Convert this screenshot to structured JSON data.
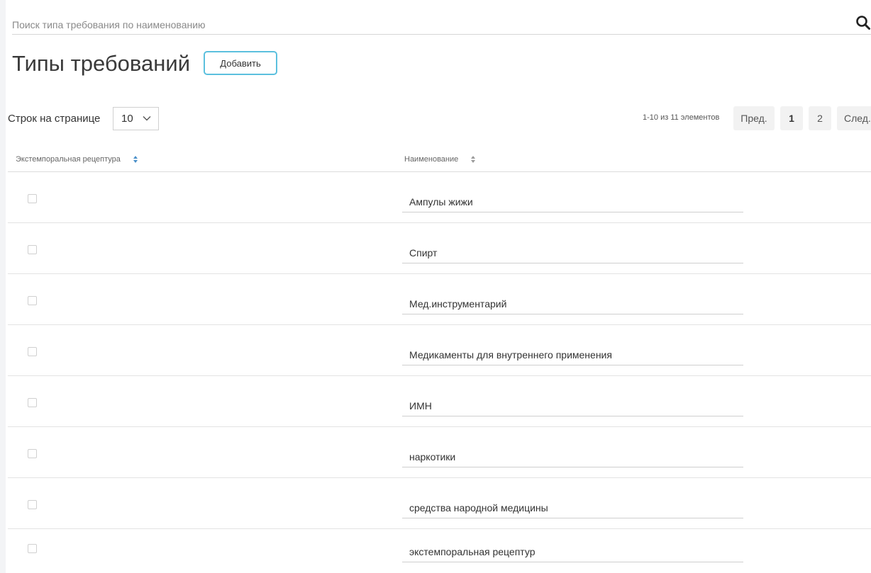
{
  "search": {
    "placeholder": "Поиск типа требования по наименованию",
    "value": ""
  },
  "page": {
    "title": "Типы требований",
    "add_label": "Добавить"
  },
  "rows_per_page": {
    "label": "Строк на странице",
    "value": "10"
  },
  "pagination": {
    "info": "1-10 из 11 элементов",
    "prev_label": "Пред.",
    "pages": [
      "1",
      "2"
    ],
    "current_page": "1",
    "next_label": "След."
  },
  "table": {
    "columns": [
      "Экстемпоральная рецептура",
      "Наименование"
    ],
    "rows": [
      {
        "checked": false,
        "name": "Ампулы жижи"
      },
      {
        "checked": false,
        "name": "Спирт"
      },
      {
        "checked": false,
        "name": "Мед.инструментарий"
      },
      {
        "checked": false,
        "name": "Медикаменты для внутреннего применения"
      },
      {
        "checked": false,
        "name": "ИМН"
      },
      {
        "checked": false,
        "name": "наркотики"
      },
      {
        "checked": false,
        "name": "средства народной медицины"
      },
      {
        "checked": false,
        "name": "экстемпоральная рецептур"
      }
    ]
  },
  "colors": {
    "accent": "#5bc0de",
    "text": "#333333",
    "divider": "#e3e3e3"
  },
  "icons": {
    "search": "search-icon",
    "dropdown": "chevron-down-icon",
    "sort": "sort-icon"
  }
}
